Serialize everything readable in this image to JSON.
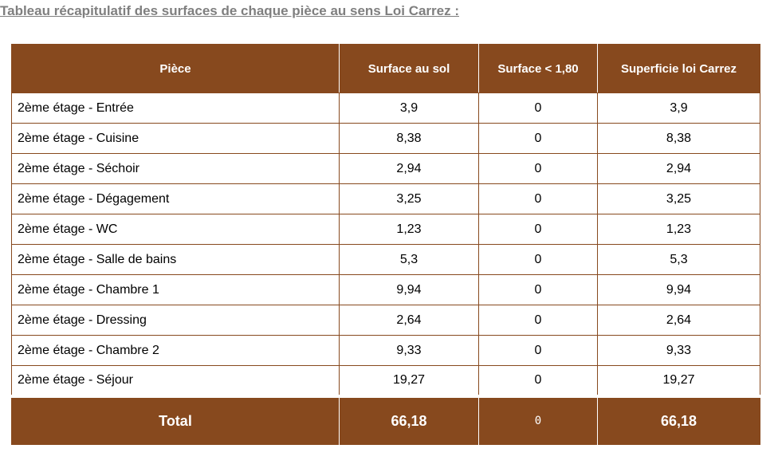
{
  "title": "Tableau récapitulatif des surfaces de chaque pièce au sens Loi Carrez :",
  "table": {
    "headers": [
      "Pièce",
      "Surface au sol",
      "Surface < 1,80",
      "Superficie loi Carrez"
    ],
    "rows": [
      [
        "2ème étage - Entrée",
        "3,9",
        "0",
        "3,9"
      ],
      [
        "2ème étage - Cuisine",
        "8,38",
        "0",
        "8,38"
      ],
      [
        "2ème étage - Séchoir",
        "2,94",
        "0",
        "2,94"
      ],
      [
        "2ème étage - Dégagement",
        "3,25",
        "0",
        "3,25"
      ],
      [
        "2ème étage - WC",
        "1,23",
        "0",
        "1,23"
      ],
      [
        "2ème étage - Salle de bains",
        "5,3",
        "0",
        "5,3"
      ],
      [
        "2ème étage - Chambre 1",
        "9,94",
        "0",
        "9,94"
      ],
      [
        "2ème étage - Dressing",
        "2,64",
        "0",
        "2,64"
      ],
      [
        "2ème étage - Chambre 2",
        "9,33",
        "0",
        "9,33"
      ],
      [
        "2ème étage - Séjour",
        "19,27",
        "0",
        "19,27"
      ]
    ],
    "total": [
      "Total",
      "66,18",
      "0",
      "66,18"
    ]
  },
  "colors": {
    "header_bg": "#87491e",
    "title_text": "#7f7f7f"
  }
}
